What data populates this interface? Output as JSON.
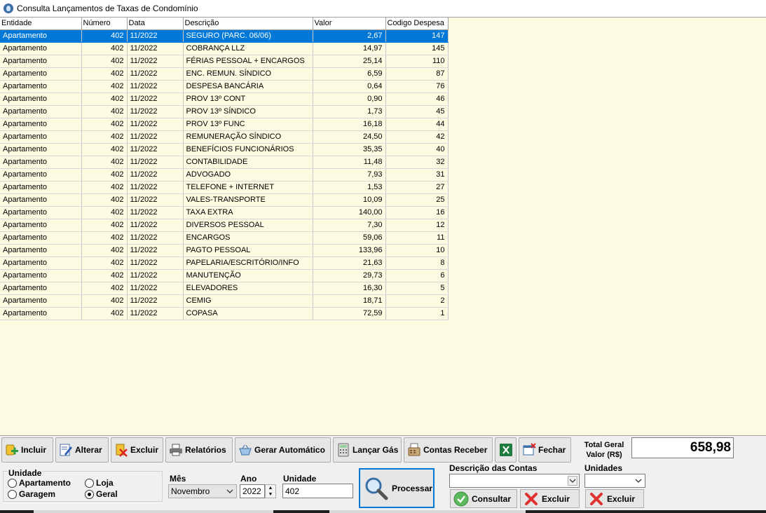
{
  "window": {
    "title": "Consulta Lançamentos de Taxas de Condomínio"
  },
  "grid": {
    "headers": [
      "Entidade",
      "Número",
      "Data",
      "Descrição",
      "Valor",
      "Codigo Despesa"
    ],
    "rows": [
      [
        "Apartamento",
        "402",
        "11/2022",
        "SEGURO (PARC. 06/06)",
        "2,67",
        "147"
      ],
      [
        "Apartamento",
        "402",
        "11/2022",
        "COBRANÇA LLZ",
        "14,97",
        "145"
      ],
      [
        "Apartamento",
        "402",
        "11/2022",
        "FÉRIAS PESSOAL + ENCARGOS",
        "25,14",
        "110"
      ],
      [
        "Apartamento",
        "402",
        "11/2022",
        "ENC. REMUN. SÍNDICO",
        "6,59",
        "87"
      ],
      [
        "Apartamento",
        "402",
        "11/2022",
        "DESPESA BANCÁRIA",
        "0,64",
        "76"
      ],
      [
        "Apartamento",
        "402",
        "11/2022",
        "PROV 13º CONT",
        "0,90",
        "46"
      ],
      [
        "Apartamento",
        "402",
        "11/2022",
        "PROV 13º SÍNDICO",
        "1,73",
        "45"
      ],
      [
        "Apartamento",
        "402",
        "11/2022",
        "PROV 13º FUNC",
        "16,18",
        "44"
      ],
      [
        "Apartamento",
        "402",
        "11/2022",
        "REMUNERAÇÃO SÍNDICO",
        "24,50",
        "42"
      ],
      [
        "Apartamento",
        "402",
        "11/2022",
        "BENEFÍCIOS FUNCIONÁRIOS",
        "35,35",
        "40"
      ],
      [
        "Apartamento",
        "402",
        "11/2022",
        "CONTABILIDADE",
        "11,48",
        "32"
      ],
      [
        "Apartamento",
        "402",
        "11/2022",
        "ADVOGADO",
        "7,93",
        "31"
      ],
      [
        "Apartamento",
        "402",
        "11/2022",
        "TELEFONE + INTERNET",
        "1,53",
        "27"
      ],
      [
        "Apartamento",
        "402",
        "11/2022",
        "VALES-TRANSPORTE",
        "10,09",
        "25"
      ],
      [
        "Apartamento",
        "402",
        "11/2022",
        "TAXA EXTRA",
        "140,00",
        "16"
      ],
      [
        "Apartamento",
        "402",
        "11/2022",
        "DIVERSOS PESSOAL",
        "7,30",
        "12"
      ],
      [
        "Apartamento",
        "402",
        "11/2022",
        "ENCARGOS",
        "59,06",
        "11"
      ],
      [
        "Apartamento",
        "402",
        "11/2022",
        "PAGTO PESSOAL",
        "133,96",
        "10"
      ],
      [
        "Apartamento",
        "402",
        "11/2022",
        "PAPELARIA/ESCRITÓRIO/INFO",
        "21,63",
        "8"
      ],
      [
        "Apartamento",
        "402",
        "11/2022",
        "MANUTENÇÃO",
        "29,73",
        "6"
      ],
      [
        "Apartamento",
        "402",
        "11/2022",
        "ELEVADORES",
        "16,30",
        "5"
      ],
      [
        "Apartamento",
        "402",
        "11/2022",
        "CEMIG",
        "18,71",
        "2"
      ],
      [
        "Apartamento",
        "402",
        "11/2022",
        "COPASA",
        "72,59",
        "1"
      ]
    ],
    "selected_row": 0
  },
  "toolbar": {
    "incluir": "Incluir",
    "alterar": "Alterar",
    "excluir": "Excluir",
    "relatorios": "Relatórios",
    "gerar_automatico": "Gerar Automático",
    "lancar_gas": "Lançar Gás",
    "contas_receber": "Contas Receber",
    "fechar": "Fechar"
  },
  "total": {
    "label_line1": "Total Geral",
    "label_line2": "Valor (R$)",
    "value": "658,98"
  },
  "filters": {
    "unidade_group_label": "Unidade",
    "radio_apartamento": "Apartamento",
    "radio_loja": "Loja",
    "radio_garagem": "Garagem",
    "radio_geral": "Geral",
    "selected_radio": "Geral",
    "mes_label": "Mês",
    "mes_value": "Novembro",
    "ano_label": "Ano",
    "ano_value": "2022",
    "unidade_label": "Unidade",
    "unidade_value": "402"
  },
  "process": {
    "label": "Processar"
  },
  "contas": {
    "descricao_label": "Descrição das Contas",
    "descricao_value": "",
    "unidades_label": "Unidades",
    "unidades_value": "",
    "consultar": "Consultar",
    "excluir1": "Excluir",
    "excluir2": "Excluir"
  },
  "colors": {
    "grid_bg": "#fbfbe1",
    "selection": "#0078d7",
    "window_bg": "#f0f0f0"
  }
}
